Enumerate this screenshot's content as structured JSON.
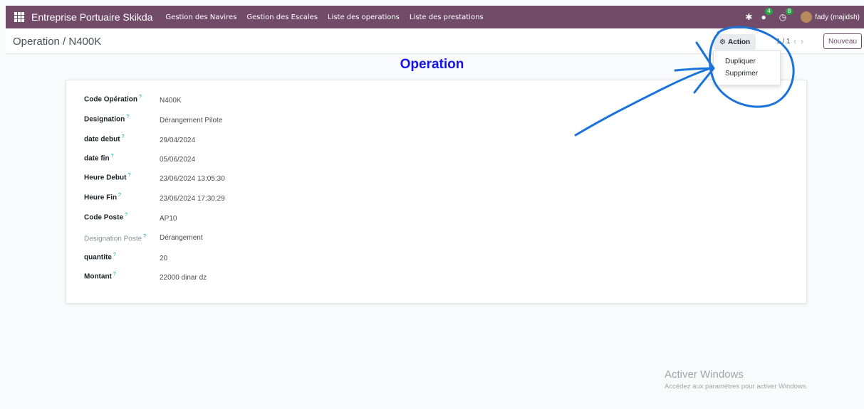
{
  "navbar": {
    "brand": "Entreprise Portuaire Skikda",
    "menu": [
      "Gestion des Navires",
      "Gestion des Escales",
      "Liste des operations",
      "Liste des prestations"
    ],
    "messages_count": "4",
    "activities_count": "8",
    "user": "fady (majidsh)"
  },
  "control": {
    "breadcrumb": "Operation / N400K",
    "action_label": "Action",
    "pager": "1 / 1",
    "new_label": "Nouveau"
  },
  "dropdown": {
    "items": [
      "Dupliquer",
      "Supprimer"
    ]
  },
  "title": "Operation",
  "form": {
    "fields": [
      {
        "label": "Code Opération",
        "value": "N400K"
      },
      {
        "label": "Designation",
        "value": "Dérangement Pilote"
      },
      {
        "label": "date debut",
        "value": "29/04/2024"
      },
      {
        "label": "date fin",
        "value": "05/06/2024"
      },
      {
        "label": "Heure Debut",
        "value": "23/06/2024 13:05:30"
      },
      {
        "label": "Heure Fin",
        "value": "23/06/2024 17:30:29"
      },
      {
        "label": "Code Poste",
        "value": "AP10"
      },
      {
        "label": "Designation Poste",
        "value": "Dérangement"
      },
      {
        "label": "quantite",
        "value": "20"
      },
      {
        "label": "Montant",
        "value": "22000 dinar dz"
      }
    ],
    "help_mark": "?"
  },
  "watermark": {
    "line1": "Activer Windows",
    "line2": "Accédez aux paramètres pour activer Windows."
  },
  "colors": {
    "navbar": "#714b67",
    "title": "#1515e8",
    "annotation": "#1a73d9",
    "badge": "#28a745"
  }
}
